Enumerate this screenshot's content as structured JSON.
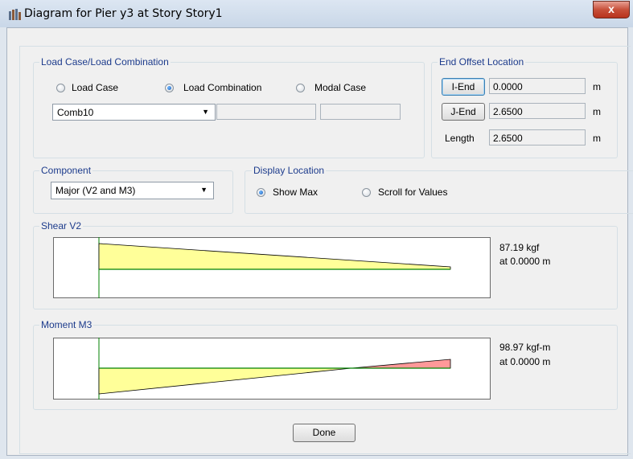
{
  "window": {
    "title": "Diagram for Pier y3 at Story Story1",
    "close_label": "x"
  },
  "load_case": {
    "group_label": "Load Case/Load Combination",
    "options": [
      {
        "label": "Load Case",
        "selected": false
      },
      {
        "label": "Load Combination",
        "selected": true
      },
      {
        "label": "Modal Case",
        "selected": false
      }
    ],
    "selected_combo": "Comb10"
  },
  "end_offset": {
    "group_label": "End Offset Location",
    "i_end_label": "I-End",
    "i_end_value": "0.0000",
    "j_end_label": "J-End",
    "j_end_value": "2.6500",
    "length_label": "Length",
    "length_value": "2.6500",
    "unit": "m"
  },
  "component": {
    "group_label": "Component",
    "selected": "Major (V2 and M3)"
  },
  "display_location": {
    "group_label": "Display Location",
    "options": [
      {
        "label": "Show Max",
        "selected": true
      },
      {
        "label": "Scroll for Values",
        "selected": false
      }
    ]
  },
  "shear": {
    "group_label": "Shear V2",
    "value_text": "87.19 kgf",
    "location_text": "at 0.0000 m",
    "colors": {
      "positive": "#ffff99",
      "outline": "#000000",
      "axis": "#008000"
    }
  },
  "moment": {
    "group_label": "Moment M3",
    "value_text": "98.97 kgf-m",
    "location_text": "at 0.0000 m",
    "colors": {
      "positive": "#ffff99",
      "negative": "#ff9999",
      "outline": "#000000",
      "axis": "#008000"
    }
  },
  "done_label": "Done"
}
